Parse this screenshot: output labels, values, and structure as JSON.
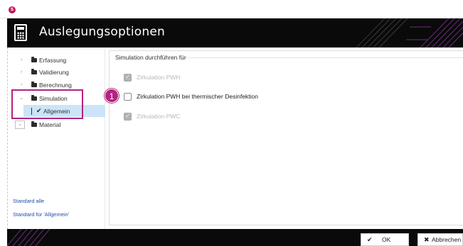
{
  "window": {
    "title": "Auslegungsoptionen",
    "app_badge": "S"
  },
  "tree": {
    "items": [
      {
        "label": "Erfassung"
      },
      {
        "label": "Validierung"
      },
      {
        "label": "Berechnung"
      },
      {
        "label": "Simulation"
      },
      {
        "label": "Allgemein"
      },
      {
        "label": "Material"
      }
    ]
  },
  "links": {
    "standard_all": "Standard alle",
    "standard_current": "Standard für 'Allgemein'"
  },
  "main": {
    "group_title": "Simulation durchführen für",
    "options": [
      {
        "label": "Zirkulation PWH",
        "checked": true,
        "enabled": false
      },
      {
        "label": "Zirkulation PWH bei thermischer Desinfektion",
        "checked": false,
        "enabled": true
      },
      {
        "label": "Zirkulation PWC",
        "checked": true,
        "enabled": false
      }
    ],
    "callout": "1"
  },
  "buttons": {
    "ok": "OK",
    "cancel": "Abbrechen"
  },
  "colors": {
    "accent": "#b4237f",
    "header": "#0a0a0a",
    "selection": "#cce4f7",
    "link": "#1f4fa8"
  },
  "icons": {
    "window": "calculator-icon",
    "folder": "folder-icon",
    "ok": "checkmark-icon",
    "cancel": "x-icon"
  }
}
